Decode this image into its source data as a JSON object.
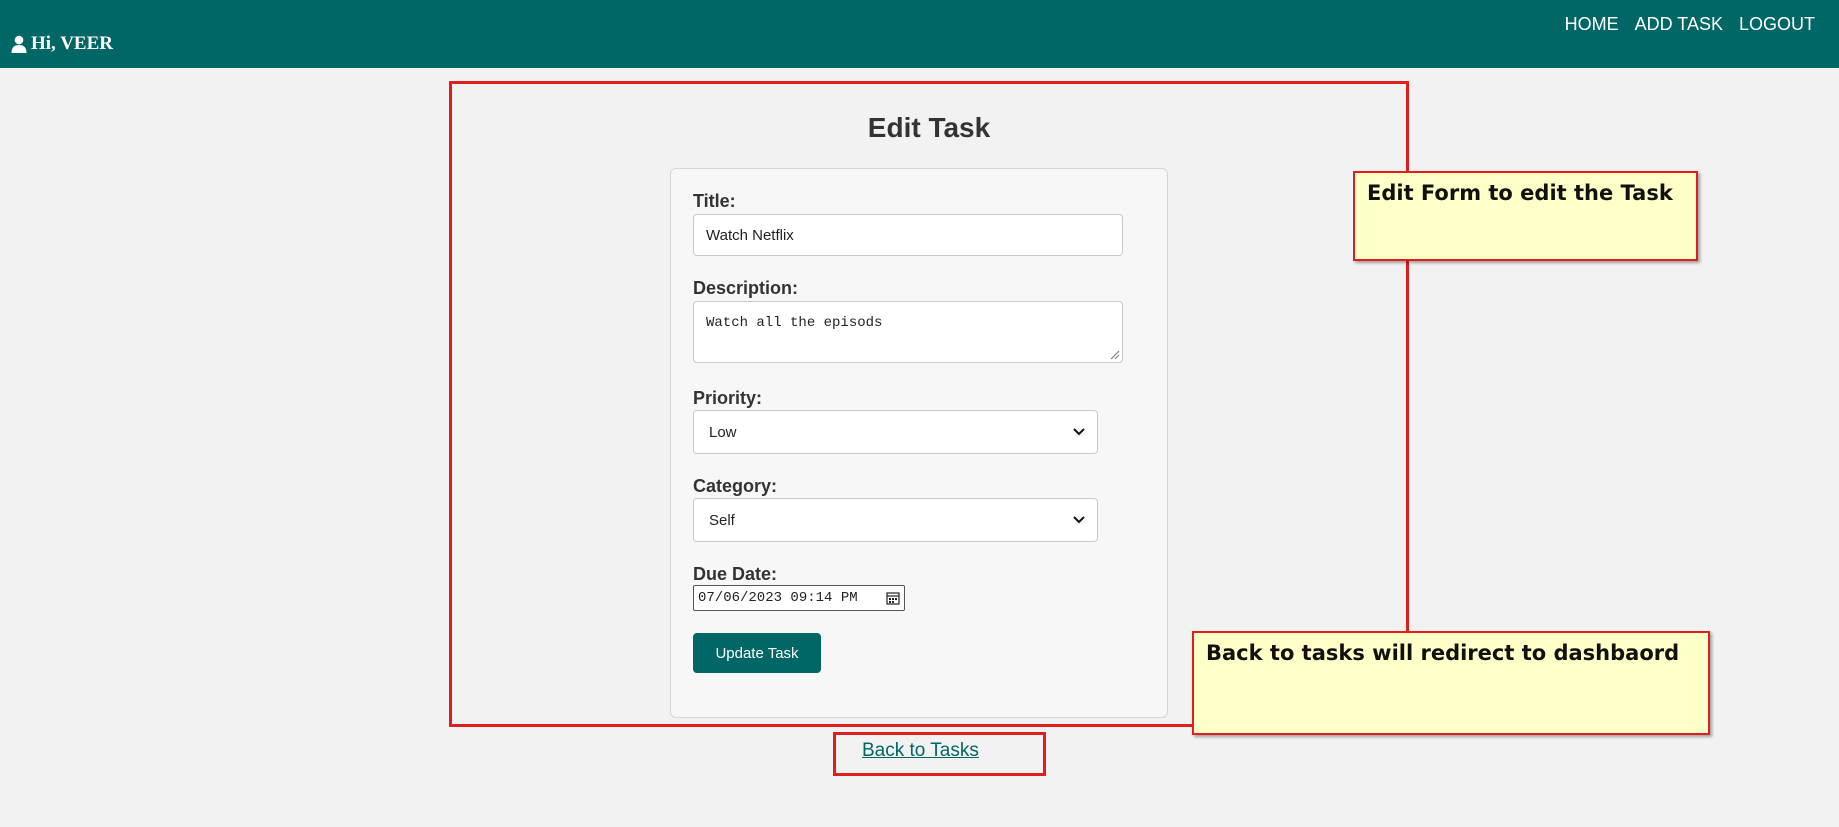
{
  "header": {
    "greeting": "Hi, VEER",
    "user_icon": "user-icon",
    "nav": [
      "HOME",
      "ADD TASK",
      "LOGOUT"
    ]
  },
  "form": {
    "title": "Edit Task",
    "title_label": "Title:",
    "title_value": "Watch Netflix",
    "description_label": "Description:",
    "description_value": "Watch all the episods",
    "priority_label": "Priority:",
    "priority_value": "Low",
    "category_label": "Category:",
    "category_value": "Self",
    "due_label": "Due Date:",
    "due_value": "07/06/2023 09:14 PM",
    "submit_label": "Update Task"
  },
  "back_link": "Back to Tasks",
  "annotations": {
    "edit_note": "Edit Form to edit the Task",
    "back_note": "Back to tasks will redirect to dashbaord"
  },
  "colors": {
    "brand": "#006666",
    "highlight": "#e01e1e",
    "note_bg": "#ffffc8"
  }
}
